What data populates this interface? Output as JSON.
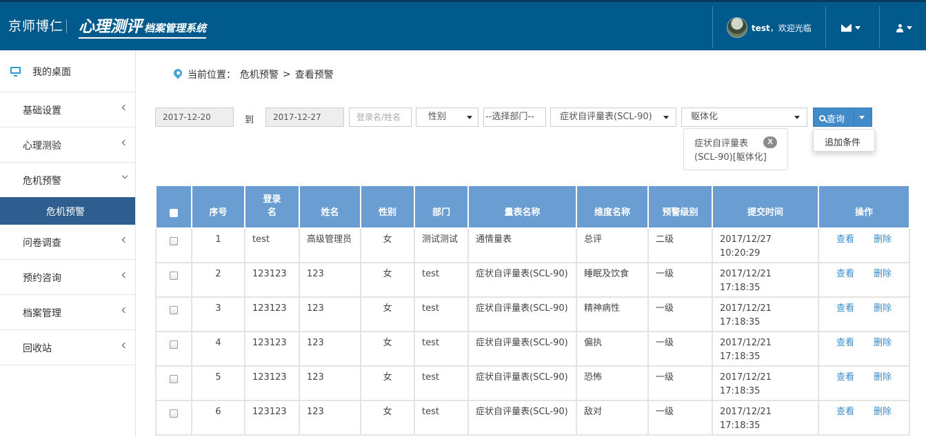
{
  "header": {
    "brand": "京师博仁",
    "logo_big": "心理测评",
    "logo_small": "档案管理系统",
    "username": "test",
    "welcome": "，欢迎光临"
  },
  "sidebar": {
    "items": [
      {
        "label": "我的桌面"
      },
      {
        "label": "基础设置"
      },
      {
        "label": "心理测验"
      },
      {
        "label": "危机预警"
      },
      {
        "label": "问卷调查"
      },
      {
        "label": "预约咨询"
      },
      {
        "label": "档案管理"
      },
      {
        "label": "回收站"
      }
    ],
    "active_sub": "危机预警"
  },
  "breadcrumb": {
    "prefix": "当前位置：",
    "level1": "危机预警",
    "sep": ">",
    "level2": "查看预警"
  },
  "filters": {
    "date_from": "2017-12-20",
    "to_label": "到",
    "date_to": "2017-12-27",
    "name_placeholder": "登录名/姓名",
    "gender": "性别",
    "department": "--选择部门--",
    "scale": "症状自评量表(SCL-90)",
    "dimension": "躯体化",
    "query_label": "查询",
    "dropdown_item": "追加条件",
    "tag_line1": "症状自评量表",
    "tag_line2": "(SCL-90)[躯体化]",
    "tag_close": "X"
  },
  "table": {
    "headers": [
      "序号",
      "登录名",
      "姓名",
      "性别",
      "部门",
      "量表名称",
      "维度名称",
      "预警级别",
      "提交时间",
      "操作"
    ],
    "view_label": "查看",
    "delete_label": "删除",
    "rows": [
      {
        "no": "1",
        "login": "test",
        "name": "高级管理员",
        "gender": "女",
        "dept": "测试测试",
        "scale": "通情量表",
        "dim": "总评",
        "level": "二级",
        "date": "2017/12/27",
        "time": "10:20:29"
      },
      {
        "no": "2",
        "login": "123123",
        "name": "123",
        "gender": "女",
        "dept": "test",
        "scale": "症状自评量表(SCL-90)",
        "dim": "睡眠及饮食",
        "level": "一级",
        "date": "2017/12/21",
        "time": "17:18:35"
      },
      {
        "no": "3",
        "login": "123123",
        "name": "123",
        "gender": "女",
        "dept": "test",
        "scale": "症状自评量表(SCL-90)",
        "dim": "精神病性",
        "level": "一级",
        "date": "2017/12/21",
        "time": "17:18:35"
      },
      {
        "no": "4",
        "login": "123123",
        "name": "123",
        "gender": "女",
        "dept": "test",
        "scale": "症状自评量表(SCL-90)",
        "dim": "偏执",
        "level": "一级",
        "date": "2017/12/21",
        "time": "17:18:35"
      },
      {
        "no": "5",
        "login": "123123",
        "name": "123",
        "gender": "女",
        "dept": "test",
        "scale": "症状自评量表(SCL-90)",
        "dim": "恐怖",
        "level": "一级",
        "date": "2017/12/21",
        "time": "17:18:35"
      },
      {
        "no": "6",
        "login": "123123",
        "name": "123",
        "gender": "女",
        "dept": "test",
        "scale": "症状自评量表(SCL-90)",
        "dim": "敌对",
        "level": "一级",
        "date": "2017/12/21",
        "time": "17:18:35"
      }
    ]
  }
}
